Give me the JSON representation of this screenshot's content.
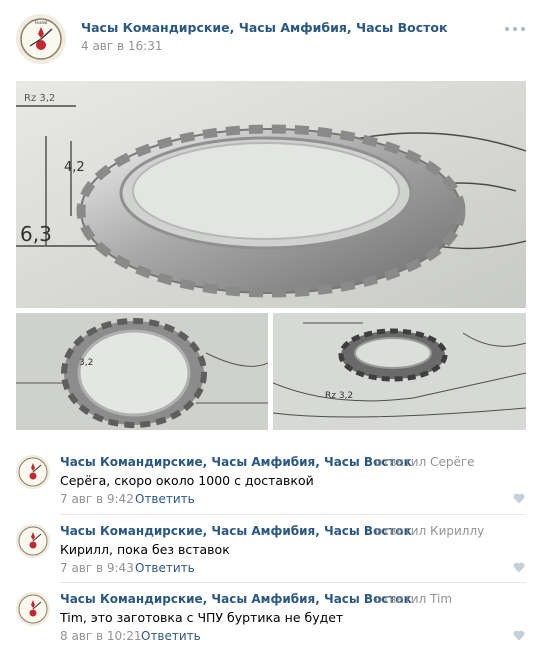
{
  "post": {
    "author": "Часы Командирские, Часы Амфибия, Часы Восток",
    "date": "4 авг в 16:31",
    "more_icon": "more-dots-icon"
  },
  "photos": {
    "main_dimension_label_1": "6,3",
    "main_dimension_label_2": "4,2",
    "main_dimension_label_3": "Rz 3,2",
    "left_dimension_label": "3,2",
    "right_dimension_label": "Rz 3,2"
  },
  "replies": [
    {
      "author": "Часы Командирские, Часы Амфибия, Часы Восток",
      "reply_to": "ответил Серёге",
      "text": "Серёга, скоро около 1000 с доставкой",
      "date": "7 авг в 9:42",
      "answer_label": "Ответить"
    },
    {
      "author": "Часы Командирские, Часы Амфибия, Часы Восток",
      "reply_to": "ответил Кириллу",
      "text": "Кирилл, пока без вставок",
      "date": "7 авг в 9:43",
      "answer_label": "Ответить"
    },
    {
      "author": "Часы Командирские, Часы Амфибия, Часы Восток",
      "reply_to": "ответил Tim",
      "text": "Tim, это заготовка с ЧПУ буртика не будет",
      "date": "8 авг в 10:21",
      "answer_label": "Ответить"
    }
  ],
  "colors": {
    "link": "#2a5885",
    "meta": "#939393",
    "like": "#c5d0db"
  }
}
